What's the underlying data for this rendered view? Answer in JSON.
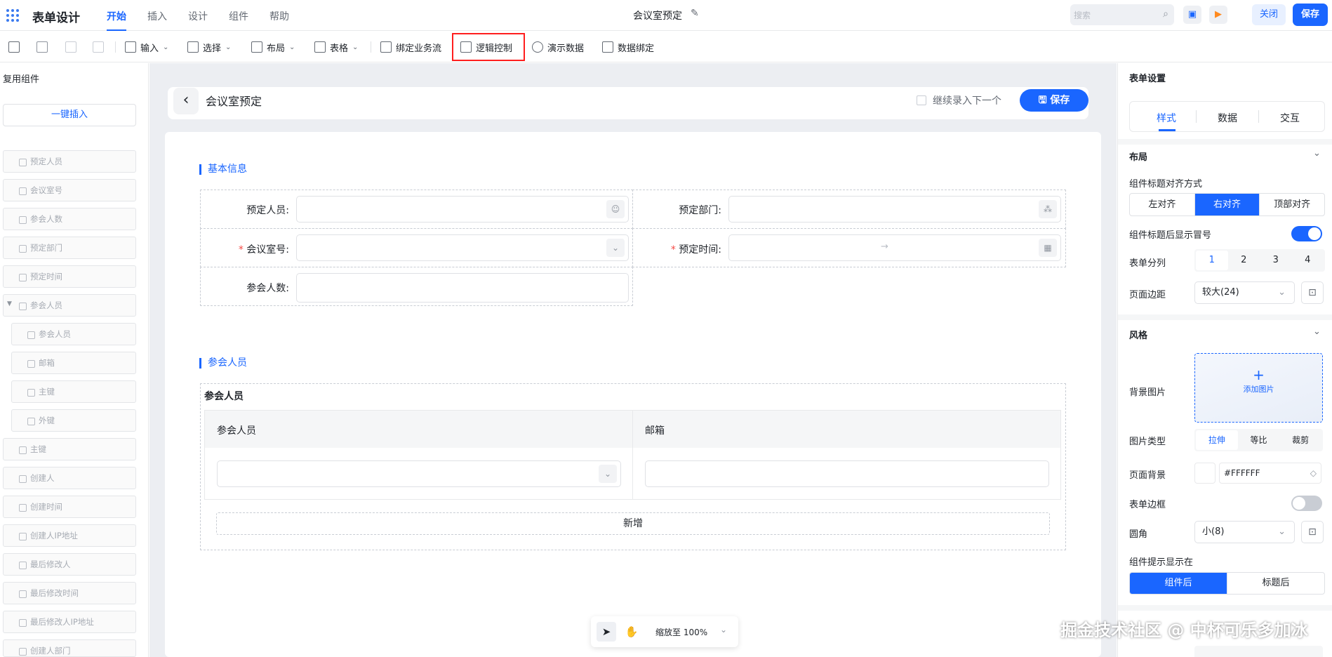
{
  "app": {
    "title": "表单设计",
    "doc_title": "会议室预定"
  },
  "top_menu": [
    {
      "label": "开始",
      "active": true
    },
    {
      "label": "插入"
    },
    {
      "label": "设计"
    },
    {
      "label": "组件"
    },
    {
      "label": "帮助"
    }
  ],
  "search": {
    "placeholder": "搜索"
  },
  "top_actions": {
    "close": "关闭",
    "save": "保存"
  },
  "toolbar": {
    "input": "输入",
    "select": "选择",
    "layout": "布局",
    "table": "表格",
    "bind_flow": "绑定业务流",
    "logic": "逻辑控制",
    "demo_data": "演示数据",
    "data_bind": "数据绑定"
  },
  "left_panel": {
    "header": "复用组件",
    "one_click": "一键插入",
    "items": [
      "预定人员",
      "会议室号",
      "参会人数",
      "预定部门",
      "预定时间",
      "参会人员",
      "参会人员",
      "邮箱",
      "主键",
      "外键",
      "主键",
      "创建人",
      "创建时间",
      "创建人IP地址",
      "最后修改人",
      "最后修改时间",
      "最后修改人IP地址",
      "创建人部门"
    ]
  },
  "form": {
    "title": "会议室预定",
    "continue_label": "继续录入下一个",
    "save": "保存",
    "section_basic": "基本信息",
    "fields": {
      "booker": "预定人员:",
      "dept": "预定部门:",
      "room": "会议室号:",
      "time": "预定时间:",
      "count": "参会人数:",
      "arrow": "→",
      "required": "*"
    },
    "section_people": "参会人员",
    "subform_title": "参会人员",
    "sub_cols": [
      "参会人员",
      "邮箱"
    ],
    "add": "新增"
  },
  "zoom": {
    "label": "缩放至 100%"
  },
  "right_panel": {
    "title": "表单设置",
    "tabs": [
      "样式",
      "数据",
      "交互"
    ],
    "layout_section": "布局",
    "title_align_label": "组件标题对齐方式",
    "align_options": [
      "左对齐",
      "右对齐",
      "顶部对齐"
    ],
    "colon_label": "组件标题后显示冒号",
    "colon_on": true,
    "columns_label": "表单分列",
    "columns_options": [
      "1",
      "2",
      "3",
      "4"
    ],
    "margin_label": "页面边距",
    "margin_value": "较大(24)",
    "style_section": "风格",
    "bg_image_label": "背景图片",
    "add_image": "添加图片",
    "image_type_label": "图片类型",
    "image_type_options": [
      "拉伸",
      "等比",
      "裁剪"
    ],
    "page_bg_label": "页面背景",
    "page_bg_value": "#FFFFFF",
    "border_label": "表单边框",
    "border_on": false,
    "radius_label": "圆角",
    "radius_value": "小(8)",
    "hint_label": "组件提示显示在",
    "hint_options": [
      "组件后",
      "标题后"
    ]
  },
  "watermark": "掘金技术社区 @ 中杯可乐多加冰",
  "colors": {
    "primary": "#1a66ff",
    "highlight_box": "#ff1e1e"
  }
}
